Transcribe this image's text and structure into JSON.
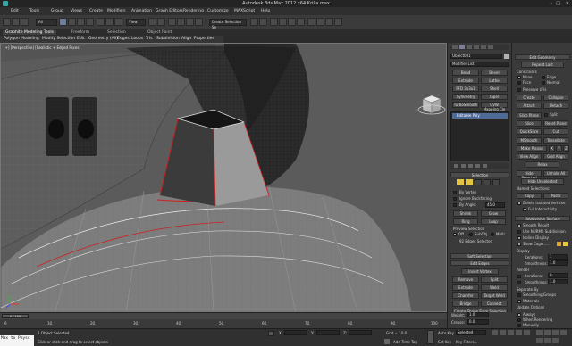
{
  "app": {
    "title": "Autodesk 3ds Max  2012 x64     Krilla.max"
  },
  "menu": [
    "Edit",
    "Tools",
    "Group",
    "Views",
    "Create",
    "Modifiers",
    "Animation",
    "Graph Editors",
    "Rendering",
    "Customize",
    "MAXScript",
    "Help"
  ],
  "toolbar": {
    "selection_filter": "All",
    "view_select": "View",
    "named_set": "Create Selection Se"
  },
  "ribbon_tabs": [
    "Graphite Modeling Tools",
    "Freeform",
    "Selection",
    "Object Paint"
  ],
  "ribbon_buttons": [
    "Polygon Modeling",
    "Modify Selection",
    "Edit",
    "Geometry (All)",
    "Edges",
    "Loops",
    "Tris",
    "Subdivision",
    "Align",
    "Properties"
  ],
  "viewport": {
    "label": "[+] [Perspective] [Realistic + Edged Faces]"
  },
  "command_panel": {
    "object_name": "Object001",
    "modifier_list": "Modifier List",
    "buttons_row1": [
      "Bend",
      "Bevel"
    ],
    "buttons_row2": [
      "Extrude",
      "Lathe"
    ],
    "buttons_row3": [
      "FFD 3x3x3",
      "Shell"
    ],
    "buttons_row4": [
      "Symmetry",
      "Taper"
    ],
    "buttons_row5": [
      "TurboSmooth",
      "UVW Mapping Cle"
    ],
    "stack_item": "Editable Poly",
    "selection_title": "Selection",
    "by_vertex": "By Vertex",
    "ignore_backfacing": "Ignore Backfacing",
    "by_angle": "By Angle:",
    "by_angle_value": "45.0",
    "shrink": "Shrink",
    "grow": "Grow",
    "ring": "Ring",
    "loop": "Loop",
    "preview_selection": "Preview Selection",
    "preview_off": "Off",
    "preview_subobj": "SubObj",
    "preview_multi": "Multi",
    "edges_selected": "92 Edges Selected",
    "soft_selection": "Soft Selection",
    "edit_edges": "Edit Edges",
    "insert_vertex": "Insert Vertex",
    "remove": "Remove",
    "split": "Split",
    "extrude": "Extrude",
    "weld": "Weld",
    "chamfer": "Chamfer",
    "target_weld": "Target Weld",
    "bridge": "Bridge",
    "connect": "Connect",
    "create_shape": "Create Shape From Selection",
    "weight_label": "Weight:",
    "weight_value": "1.0",
    "crease_label": "Crease:",
    "crease_value": "0.0"
  },
  "graphite_panel": {
    "edit_geometry": "Edit Geometry",
    "repeat_last": "Repeat Last",
    "constraints": "Constraints",
    "none": "None",
    "edge": "Edge",
    "face": "Face",
    "normal": "Normal",
    "preserve_uvs": "Preserve UVs",
    "create": "Create",
    "collapse": "Collapse",
    "attach": "Attach",
    "detach": "Detach",
    "slice_plane": "Slice Plane",
    "split": "Split",
    "slice": "Slice",
    "reset_plane": "Reset Plane",
    "quickslice": "QuickSlice",
    "cut": "Cut",
    "msmooth": "MSmooth",
    "tessellate": "Tessellate",
    "make_planar": "Make Planar",
    "x": "X",
    "y": "Y",
    "z": "Z",
    "view_align": "View Align",
    "grid_align": "Grid Align",
    "relax": "Relax",
    "hide_selected": "Hide Selected",
    "unhide_all": "Unhide All",
    "hide_unselected": "Hide Unselected",
    "named_selections": "Named Selections:",
    "copy": "Copy",
    "paste": "Paste",
    "delete_isolated": "Delete Isolated Vertices",
    "full_interactivity": "Full Interactivity",
    "subdivision_surface": "Subdivision Surface",
    "smooth_result": "Smooth Result",
    "use_nurms": "Use NURMS Subdivision",
    "isoline_display": "Isoline Display",
    "show_cage": "Show Cage......",
    "display": "Display",
    "iterations_label": "Iterations:",
    "iterations_value": "1",
    "smoothness_label": "Smoothness:",
    "smoothness_value": "1.0",
    "render": "Render",
    "r_iterations_value": "0",
    "r_smoothness_value": "1.0",
    "separate_by": "Separate By",
    "smoothing_groups": "Smoothing Groups",
    "materials": "Materials",
    "update_options": "Update Options",
    "always": "Always",
    "when_rendering": "When Rendering",
    "manually": "Manually"
  },
  "timeline": {
    "frame": "0 / 100",
    "ticks": [
      "0",
      "10",
      "20",
      "30",
      "40",
      "50",
      "60",
      "70",
      "80",
      "90",
      "100"
    ]
  },
  "status": {
    "maxscript": "Max to Physc",
    "selected": "1 Object Selected",
    "prompt": "Click or click-and-drag to select objects",
    "x_label": "X:",
    "y_label": "Y:",
    "z_label": "Z:",
    "grid": "Grid = 10.0",
    "add_time_tag": "Add Time Tag",
    "auto_key": "Auto Key",
    "selected_dropdown": "Selected",
    "set_key": "Set Key",
    "key_filters": "Key Filters..."
  }
}
